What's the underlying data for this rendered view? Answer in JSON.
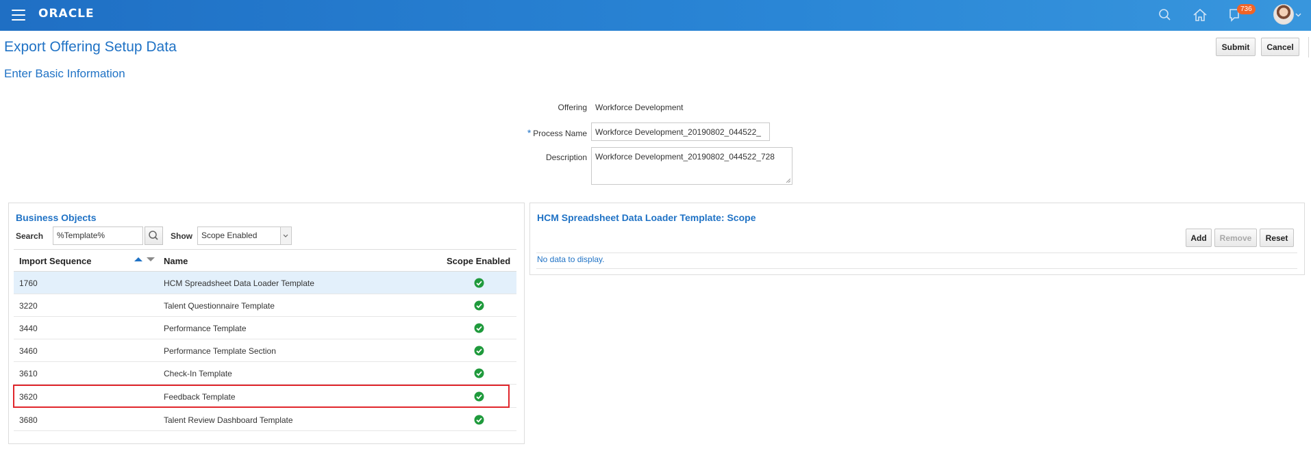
{
  "header": {
    "brand": "ORACLE",
    "notification_count": "736"
  },
  "page": {
    "title": "Export Offering Setup Data",
    "section_title": "Enter Basic Information",
    "submit_label": "Submit",
    "cancel_label": "Cancel"
  },
  "form": {
    "offering_label": "Offering",
    "offering_value": "Workforce Development",
    "process_name_label": "Process Name",
    "process_name_value": "Workforce Development_20190802_044522_",
    "description_label": "Description",
    "description_value": "Workforce Development_20190802_044522_728"
  },
  "business_objects": {
    "title": "Business Objects",
    "search_label": "Search",
    "search_value": "%Template%",
    "show_label": "Show",
    "show_value": "Scope Enabled",
    "columns": [
      "Import Sequence",
      "Name",
      "Scope Enabled"
    ],
    "rows": [
      {
        "seq": "1760",
        "name": "HCM Spreadsheet Data Loader Template",
        "scope_enabled": true
      },
      {
        "seq": "3220",
        "name": "Talent Questionnaire Template",
        "scope_enabled": true
      },
      {
        "seq": "3440",
        "name": "Performance Template",
        "scope_enabled": true
      },
      {
        "seq": "3460",
        "name": "Performance Template Section",
        "scope_enabled": true
      },
      {
        "seq": "3610",
        "name": "Check-In Template",
        "scope_enabled": true
      },
      {
        "seq": "3620",
        "name": "Feedback Template",
        "scope_enabled": true
      },
      {
        "seq": "3680",
        "name": "Talent Review Dashboard Template",
        "scope_enabled": true
      }
    ]
  },
  "scope_panel": {
    "title": "HCM Spreadsheet Data Loader Template: Scope",
    "add_label": "Add",
    "remove_label": "Remove",
    "reset_label": "Reset",
    "empty_text": "No data to display."
  },
  "colors": {
    "topbar": "#2a86d6",
    "accent": "#1f72c5",
    "badge": "#f06427",
    "check": "#1f9a3c",
    "highlight": "#e0252b",
    "selected_row": "#e3f0fb"
  }
}
